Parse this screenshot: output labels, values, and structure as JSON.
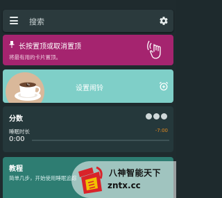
{
  "search": {
    "placeholder": "搜索"
  },
  "pin_card": {
    "title": "长按置顶或取消置顶",
    "subtitle": "将最有用的卡片置顶。",
    "color": "#a5246f"
  },
  "alarm_card": {
    "label": "设置闹铃",
    "color": "#7fcfc8"
  },
  "score_card": {
    "title": "分数",
    "sleep_label": "睡眠时长",
    "sleep_value": "0:00",
    "sleep_target": "-7:00",
    "target_color": "#e58a1f"
  },
  "tutorial_card": {
    "title": "教程",
    "subtitle": "简单几步，开始使用睡眠追踪"
  },
  "watermark": {
    "title": "八神智能天下",
    "url": "zntx.cc"
  },
  "icons": [
    "menu-icon",
    "gear-icon",
    "pin-icon",
    "touch-icon",
    "coffee-icon",
    "alarm-add-icon"
  ]
}
